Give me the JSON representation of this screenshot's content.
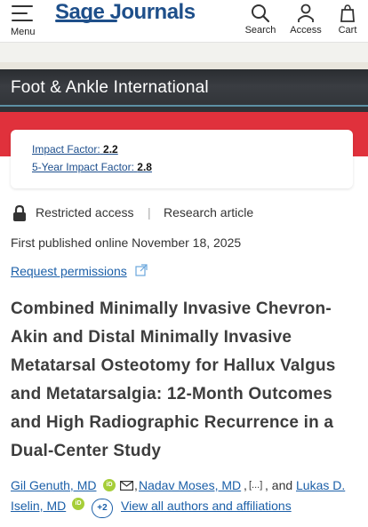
{
  "header": {
    "menu_label": "Menu",
    "logo_text": "Sage Journals",
    "search_label": "Search",
    "access_label": "Access",
    "cart_label": "Cart"
  },
  "journal": {
    "title": "Foot & Ankle International",
    "metrics": [
      {
        "label": "Impact Factor:",
        "value": "2.2"
      },
      {
        "label": "5-Year Impact Factor:",
        "value": "2.8"
      }
    ]
  },
  "article": {
    "access": "Restricted access",
    "type": "Research article",
    "published": "First published online November 18, 2025",
    "permissions_link": "Request permissions",
    "title": "Combined Minimally Invasive Chevron-Akin and Distal Minimally Invasive Metatarsal Osteotomy for Hallux Valgus and Metatarsalgia: 12-Month Outcomes and High Radiographic Recurrence in a Dual-Center Study"
  },
  "authors": {
    "first": "Gil Genuth, MD",
    "second": "Nadav Moses, MD",
    "ellipsis": "[...]",
    "and_text": ", and",
    "last_line1": "Lukas D.",
    "last_line2": "Iselin, MD",
    "more_count": "+2",
    "view_all": "View all authors and affiliations"
  },
  "colors": {
    "brand_blue": "#1e4f8a",
    "link_blue": "#1b5fa8",
    "banner_red": "#e0313c",
    "banner_dark": "#2f3236",
    "orcid_green": "#a6ce39"
  },
  "icons": [
    "menu-icon",
    "search-icon",
    "person-icon",
    "cart-icon",
    "lock-icon",
    "external-link-icon",
    "orcid-icon",
    "mail-icon"
  ]
}
